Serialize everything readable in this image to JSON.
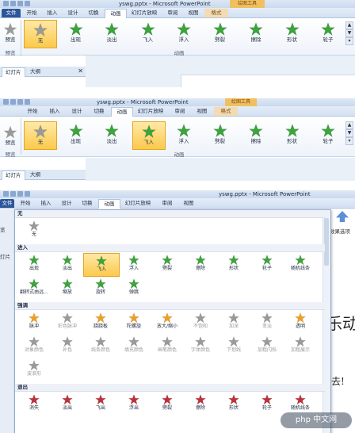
{
  "app": {
    "title": "yswg.pptx - Microsoft PowerPoint",
    "context_group": "绘图工具",
    "colors": {
      "accent": "#2b579a",
      "selected": "#fbc94c",
      "star_green": "#3aa53a",
      "star_gray": "#9a9a9a",
      "star_gold": "#f0a020",
      "star_red": "#c0303a"
    }
  },
  "panel1": {
    "tabs": [
      "文件",
      "开始",
      "插入",
      "设计",
      "切换",
      "动画",
      "幻灯片放映",
      "审阅",
      "视图",
      "格式"
    ],
    "active_tab": "动画",
    "preview_label": "预览",
    "preview_group_label": "预览",
    "animation_group_label": "动画",
    "gallery": [
      {
        "label": "无",
        "icon": "star-gray-icon",
        "selected": true
      },
      {
        "label": "出现",
        "icon": "star-green-icon"
      },
      {
        "label": "淡出",
        "icon": "star-green-icon"
      },
      {
        "label": "飞入",
        "icon": "star-green-icon"
      },
      {
        "label": "浮入",
        "icon": "star-green-icon"
      },
      {
        "label": "劈裂",
        "icon": "star-green-icon"
      },
      {
        "label": "擦除",
        "icon": "star-green-icon"
      },
      {
        "label": "形状",
        "icon": "star-green-icon"
      },
      {
        "label": "轮子",
        "icon": "star-green-icon"
      }
    ],
    "side_tabs": [
      "幻灯片",
      "大纲"
    ]
  },
  "panel2": {
    "title": "yswg.pptx - Microsoft PowerPoint",
    "context_group": "绘图工具",
    "tabs": [
      "开始",
      "插入",
      "设计",
      "切换",
      "动画",
      "幻灯片放映",
      "审阅",
      "视图",
      "格式"
    ],
    "active_tab": "动画",
    "preview_label": "预览",
    "preview_group_label": "预览",
    "animation_group_label": "动画",
    "gallery": [
      {
        "label": "无",
        "icon": "star-gray-icon",
        "selected": true
      },
      {
        "label": "出现",
        "icon": "star-green-icon"
      },
      {
        "label": "淡出",
        "icon": "star-green-icon"
      },
      {
        "label": "飞入",
        "icon": "star-green-icon",
        "selected": true
      },
      {
        "label": "浮入",
        "icon": "star-green-icon"
      },
      {
        "label": "劈裂",
        "icon": "star-green-icon"
      },
      {
        "label": "擦除",
        "icon": "star-green-icon"
      },
      {
        "label": "形状",
        "icon": "star-green-icon"
      },
      {
        "label": "轮子",
        "icon": "star-green-icon"
      }
    ],
    "side_tabs": [
      "幻灯片",
      "大纲"
    ]
  },
  "panel3": {
    "title": "yswg.pptx - Microsoft PowerPoint",
    "tabs": [
      "文件",
      "开始",
      "插入",
      "设计",
      "切换",
      "动画",
      "幻灯片放映",
      "审阅",
      "视图"
    ],
    "active_tab": "动画",
    "left_labels": [
      "览",
      "灯片"
    ],
    "right_label": "效果选项",
    "big_chars": [
      "乐动",
      "去!"
    ],
    "sections": [
      {
        "name": "无",
        "items": [
          {
            "label": "无",
            "color": "gray"
          }
        ]
      },
      {
        "name": "进入",
        "items": [
          {
            "label": "出现",
            "color": "green"
          },
          {
            "label": "淡出",
            "color": "green"
          },
          {
            "label": "飞入",
            "color": "green",
            "selected": true
          },
          {
            "label": "浮入",
            "color": "green"
          },
          {
            "label": "劈裂",
            "color": "green"
          },
          {
            "label": "擦除",
            "color": "green"
          },
          {
            "label": "形状",
            "color": "green"
          },
          {
            "label": "轮子",
            "color": "green"
          },
          {
            "label": "随机线条",
            "color": "green"
          },
          {
            "label": "翻转式由远...",
            "color": "green"
          },
          {
            "label": "缩放",
            "color": "green"
          },
          {
            "label": "旋转",
            "color": "green"
          },
          {
            "label": "弹跳",
            "color": "green"
          }
        ]
      },
      {
        "name": "强调",
        "items": [
          {
            "label": "脉冲",
            "color": "gold"
          },
          {
            "label": "彩色脉冲",
            "color": "gray",
            "disabled": true
          },
          {
            "label": "跷跷板",
            "color": "gold"
          },
          {
            "label": "陀螺旋",
            "color": "gold"
          },
          {
            "label": "放大/缩小",
            "color": "gold"
          },
          {
            "label": "不饱和",
            "color": "gray",
            "disabled": true
          },
          {
            "label": "加深",
            "color": "gray",
            "disabled": true
          },
          {
            "label": "变淡",
            "color": "gray",
            "disabled": true
          },
          {
            "label": "透明",
            "color": "gold"
          },
          {
            "label": "对象颜色",
            "color": "gray",
            "disabled": true
          },
          {
            "label": "补色",
            "color": "gray",
            "disabled": true
          },
          {
            "label": "线条颜色",
            "color": "gray",
            "disabled": true
          },
          {
            "label": "填充颜色",
            "color": "gray",
            "disabled": true
          },
          {
            "label": "画笔颜色",
            "color": "gray",
            "disabled": true
          },
          {
            "label": "字体颜色",
            "color": "gray",
            "disabled": true
          },
          {
            "label": "下划线",
            "color": "gray",
            "disabled": true
          },
          {
            "label": "加粗闪烁",
            "color": "gray",
            "disabled": true
          },
          {
            "label": "加粗展示",
            "color": "gray",
            "disabled": true
          },
          {
            "label": "波浪形",
            "color": "gray",
            "disabled": true
          }
        ]
      },
      {
        "name": "退出",
        "items": [
          {
            "label": "消失",
            "color": "red"
          },
          {
            "label": "淡出",
            "color": "red"
          },
          {
            "label": "飞出",
            "color": "red"
          },
          {
            "label": "浮出",
            "color": "red"
          },
          {
            "label": "劈裂",
            "color": "red"
          },
          {
            "label": "擦除",
            "color": "red"
          },
          {
            "label": "形状",
            "color": "red"
          },
          {
            "label": "轮子",
            "color": "red"
          },
          {
            "label": "随机线条",
            "color": "red"
          }
        ]
      }
    ],
    "watermark": "php 中文网"
  }
}
